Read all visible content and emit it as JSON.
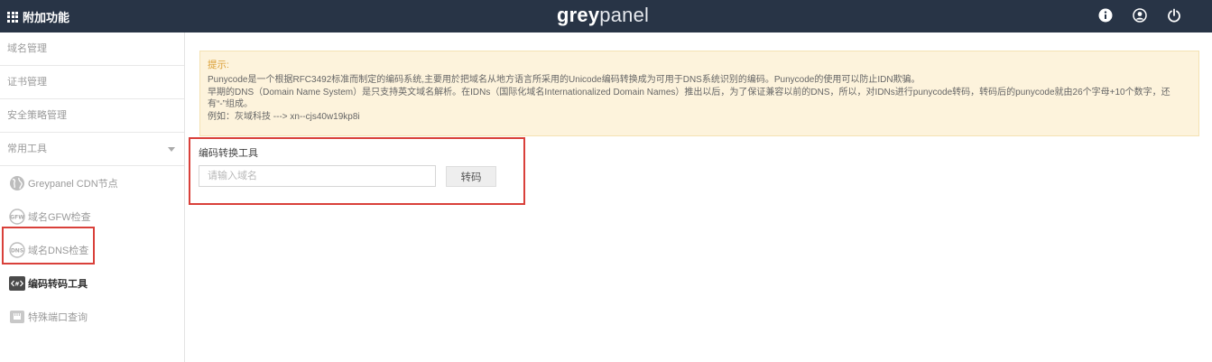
{
  "header": {
    "menu_label": "附加功能",
    "logo_bold": "grey",
    "logo_light": "panel",
    "icons": [
      "info-icon",
      "user-icon",
      "power-icon"
    ]
  },
  "sidebar": {
    "items": [
      {
        "label": "域名管理"
      },
      {
        "label": "证书管理"
      },
      {
        "label": "安全策略管理"
      },
      {
        "label": "常用工具",
        "expanded": true
      }
    ],
    "sub_items": [
      {
        "label": "Greypanel CDN节点",
        "icon": "globe-icon"
      },
      {
        "label": "域名GFW检查",
        "icon": "gfw-icon"
      },
      {
        "label": "域名DNS检查",
        "icon": "dns-icon"
      },
      {
        "label": "编码转码工具",
        "icon": "code-icon",
        "active": true
      },
      {
        "label": "特殊端口查询",
        "icon": "port-icon"
      }
    ]
  },
  "notice": {
    "title": "提示:",
    "line1": "Punycode是一个根据RFC3492标准而制定的编码系统,主要用於把域名从地方语言所采用的Unicode编码转换成为可用于DNS系统识别的编码。Punycode的使用可以防止IDN欺骗。",
    "line2": "早期的DNS（Domain Name System）是只支持英文域名解析。在IDNs（国际化域名Internationalized Domain Names）推出以后，为了保证兼容以前的DNS，所以，对IDNs进行punycode转码，转码后的punycode就由26个字母+10个数字，还有“-”组成。",
    "line3": "例如：灰域科技 ---> xn--cjs40w19kp8i"
  },
  "tool": {
    "label": "编码转换工具",
    "input_placeholder": "请输入域名",
    "input_value": "",
    "button_label": "转码"
  },
  "colors": {
    "header_bg": "#283446",
    "highlight": "#d9403a",
    "notice_bg": "#fdf3dc",
    "notice_title": "#d99d33"
  }
}
